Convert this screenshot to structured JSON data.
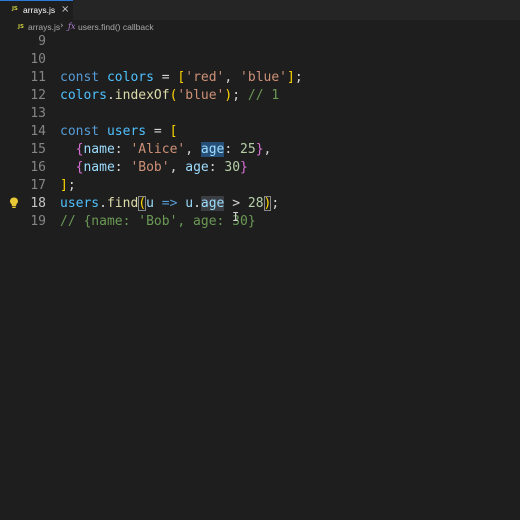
{
  "tab": {
    "badge": "JS",
    "label": "arrays.js",
    "close": "×"
  },
  "breadcrumb": {
    "badge": "JS",
    "file": "arrays.js",
    "separator": "›",
    "symbol_icon": "ƒx",
    "symbol": "users.find() callback"
  },
  "editor": {
    "line_numbers": [
      "9",
      "10",
      "11",
      "12",
      "13",
      "14",
      "15",
      "16",
      "17",
      "18",
      "19"
    ],
    "active_line": "18",
    "lightbulb_icon": "lightbulb-icon",
    "lines": {
      "l11": {
        "t1": "const",
        "t2": " ",
        "t3": "colors",
        "t4": " = ",
        "t5": "[",
        "t6": "'red'",
        "t7": ", ",
        "t8": "'blue'",
        "t9": "]",
        "t10": ";"
      },
      "l12": {
        "t1": "colors",
        "t2": ".",
        "t3": "indexOf",
        "t4": "(",
        "t5": "'blue'",
        "t6": ")",
        "t7": "; ",
        "t8": "// 1"
      },
      "l14": {
        "t1": "const",
        "t2": " ",
        "t3": "users",
        "t4": " = ",
        "t5": "["
      },
      "l15": {
        "t0": "  ",
        "t1": "{",
        "t2": "name",
        "t3": ": ",
        "t4": "'Alice'",
        "t5": ", ",
        "t6": "age",
        "t7": ": ",
        "t8": "25",
        "t9": "}",
        "t10": ","
      },
      "l16": {
        "t0": "  ",
        "t1": "{",
        "t2": "name",
        "t3": ": ",
        "t4": "'Bob'",
        "t5": ", ",
        "t6": "age",
        "t7": ": ",
        "t8": "30",
        "t9": "}"
      },
      "l17": {
        "t1": "]",
        "t2": ";"
      },
      "l18": {
        "t1": "users",
        "t2": ".",
        "t3": "find",
        "t4": "(",
        "t5": "u",
        "t6": " ",
        "t7": "=>",
        "t8": " ",
        "t9": "u",
        "t10": ".",
        "t11": "age",
        "t12": " > ",
        "t13": "28",
        "t14": ")",
        "t15": ";"
      },
      "l19": {
        "t1": "// {name: 'Bob', age: 30}"
      }
    }
  },
  "colors": {
    "background": "#1e1e1e",
    "keyword": "#569cd6",
    "string": "#ce9178",
    "number": "#b5cea8",
    "comment": "#6a9955",
    "function": "#dcdcaa",
    "variable": "#4fc1ff",
    "property": "#9cdcfe"
  }
}
